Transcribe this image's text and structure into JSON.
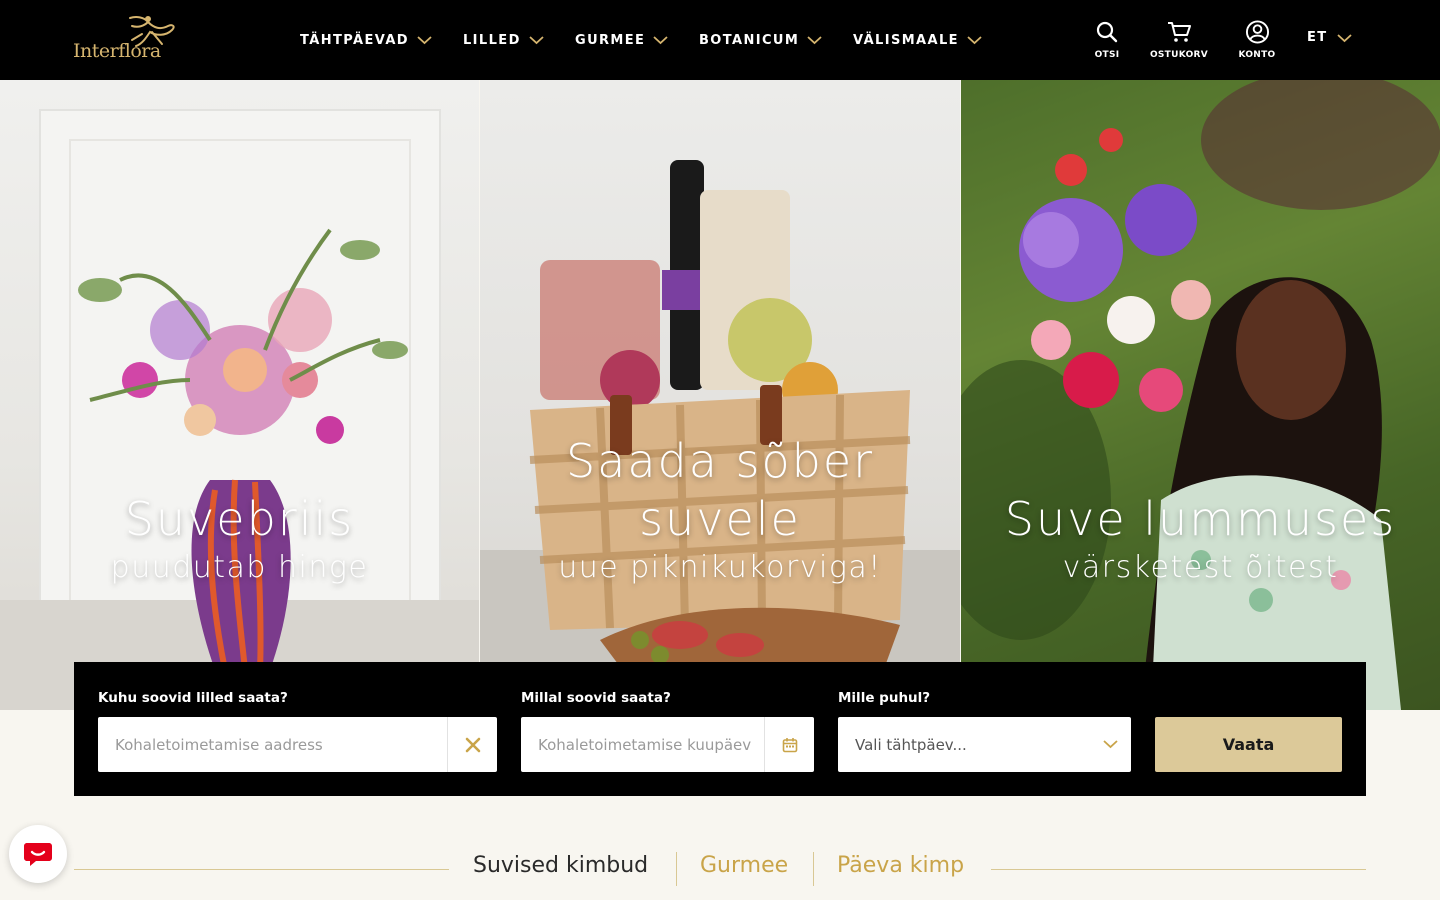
{
  "brand": {
    "name": "Interflora",
    "gold": "#d6b56f"
  },
  "nav": {
    "items": [
      {
        "label": "TÄHTPÄEVAD"
      },
      {
        "label": "LILLED"
      },
      {
        "label": "GURMEE"
      },
      {
        "label": "BOTANICUM"
      },
      {
        "label": "VÄLISMAALE"
      }
    ],
    "search_label": "OTSI",
    "cart_label": "OSTUKORV",
    "account_label": "KONTO",
    "language": "ET"
  },
  "hero": [
    {
      "title": "Suvebriis",
      "subtitle": "puudutab hinge"
    },
    {
      "title_line1": "Saada sõber",
      "title_line2": "suvele",
      "subtitle": "uue piknikukorviga!"
    },
    {
      "title": "Suve lummuses",
      "subtitle": "värsketest õitest"
    }
  ],
  "search": {
    "address_label": "Kuhu soovid lilled saata?",
    "address_placeholder": "Kohaletoimetamise aadress",
    "date_label": "Millal soovid saata?",
    "date_placeholder": "Kohaletoimetamise kuupäev",
    "occasion_label": "Mille puhul?",
    "occasion_value": "Vali tähtpäev...",
    "submit_label": "Vaata"
  },
  "tabs": {
    "items": [
      {
        "label": "Suvised kimbud",
        "active": true
      },
      {
        "label": "Gurmee",
        "active": false
      },
      {
        "label": "Päeva kimp",
        "active": false
      }
    ],
    "active_color": "#2a2a2a",
    "inactive_color": "#c9a449"
  },
  "colors": {
    "accent": "#dcc999",
    "header_bg": "#000000",
    "page_bg": "#f8f6f0"
  }
}
